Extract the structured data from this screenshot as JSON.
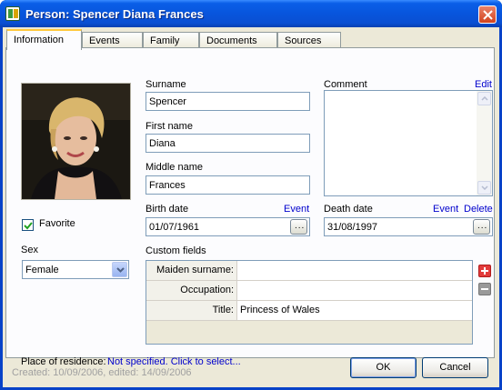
{
  "window": {
    "title": "Person: Spencer Diana Frances"
  },
  "tabs": [
    {
      "label": "Information"
    },
    {
      "label": "Events"
    },
    {
      "label": "Family"
    },
    {
      "label": "Documents"
    },
    {
      "label": "Sources"
    }
  ],
  "photo": {
    "icon": "person-photo"
  },
  "favorite": {
    "label": "Favorite",
    "checked": true
  },
  "sex": {
    "label": "Sex",
    "value": "Female"
  },
  "surname": {
    "label": "Surname",
    "value": "Spencer"
  },
  "first_name": {
    "label": "First name",
    "value": "Diana"
  },
  "middle_name": {
    "label": "Middle name",
    "value": "Frances"
  },
  "comment": {
    "label": "Comment",
    "edit_link": "Edit",
    "value": ""
  },
  "birth": {
    "label": "Birth date",
    "event_link": "Event",
    "value": "01/07/1961",
    "button": "..."
  },
  "death": {
    "label": "Death date",
    "event_link": "Event",
    "delete_link": "Delete",
    "value": "31/08/1997",
    "button": "..."
  },
  "custom_fields": {
    "label": "Custom fields",
    "rows": [
      {
        "key": "Maiden surname:",
        "value": ""
      },
      {
        "key": "Occupation:",
        "value": ""
      },
      {
        "key": "Title:",
        "value": "Princess of Wales"
      }
    ]
  },
  "residence": {
    "label": "Place of residence:",
    "value": "Not specified. Click to select..."
  },
  "footer": {
    "created": "Created: 10/09/2006, edited: 14/09/2006"
  },
  "buttons": {
    "ok": "OK",
    "cancel": "Cancel"
  },
  "colors": {
    "title_bar": "#0855dd",
    "link": "#0000cc",
    "add_button": "#e23b3b",
    "tab_highlight": "#ffc83c"
  }
}
